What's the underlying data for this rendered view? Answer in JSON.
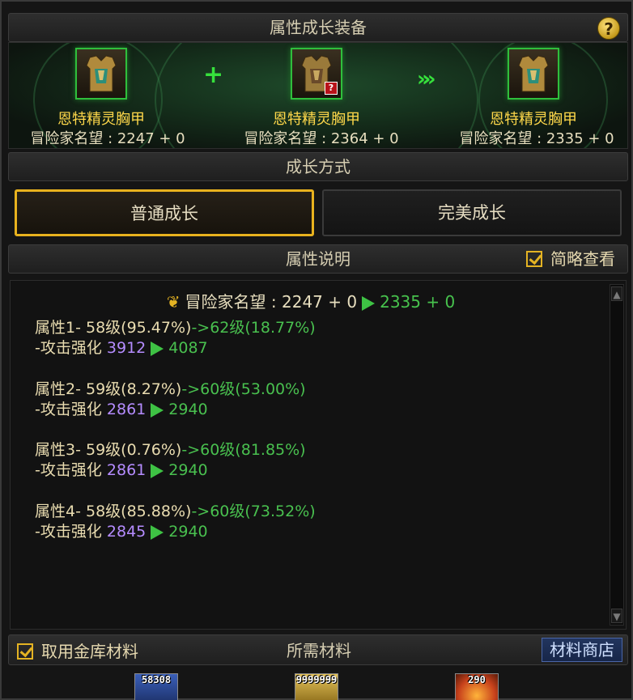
{
  "window": {
    "title": "属性成长装备",
    "help_label": "?"
  },
  "equipment": {
    "plus_symbol": "+",
    "arrow_symbol": "»»",
    "slots": [
      {
        "name": "恩特精灵胸甲",
        "reputation": "冒险家名望 : 2247 + 0"
      },
      {
        "name": "恩特精灵胸甲",
        "reputation": "冒险家名望 : 2364 + 0",
        "badge": "?"
      },
      {
        "name": "恩特精灵胸甲",
        "reputation": "冒险家名望 : 2335 + 0"
      }
    ]
  },
  "growth": {
    "title": "成长方式",
    "normal_label": "普通成长",
    "perfect_label": "完美成长",
    "selected": "normal"
  },
  "description": {
    "title": "属性说明",
    "brief_view_label": "简略查看",
    "brief_view_checked": true,
    "summary": {
      "label": "冒险家名望 :",
      "from": "2247 + 0",
      "to": "2335 + 0"
    },
    "attributes": [
      {
        "name": "属性1- ",
        "current": "58级(95.47%)",
        "next": "->62级(18.77%)",
        "stat": "-攻击强化",
        "stat_from": "3912",
        "stat_to": "4087"
      },
      {
        "name": "属性2- ",
        "current": "59级(8.27%)",
        "next": "->60级(53.00%)",
        "stat": "-攻击强化",
        "stat_from": "2861",
        "stat_to": "2940"
      },
      {
        "name": "属性3- ",
        "current": "59级(0.76%)",
        "next": "->60级(81.85%)",
        "stat": "-攻击强化",
        "stat_from": "2861",
        "stat_to": "2940"
      },
      {
        "name": "属性4- ",
        "current": "58级(85.88%)",
        "next": "->60级(73.52%)",
        "stat": "-攻击强化",
        "stat_from": "2845",
        "stat_to": "2940"
      }
    ]
  },
  "materials": {
    "vault_label": "取用金库材料",
    "vault_checked": true,
    "title": "所需材料",
    "shop_label": "材料商店",
    "items": [
      {
        "count": "58308",
        "color": "#3a5fb8"
      },
      {
        "count": "9999999",
        "color": "#c9a23a"
      },
      {
        "count": "290",
        "color": "#c8421c"
      }
    ]
  },
  "colors": {
    "accent_gold": "#e8b21e",
    "green": "#49c04f",
    "purple": "#b58cff"
  }
}
